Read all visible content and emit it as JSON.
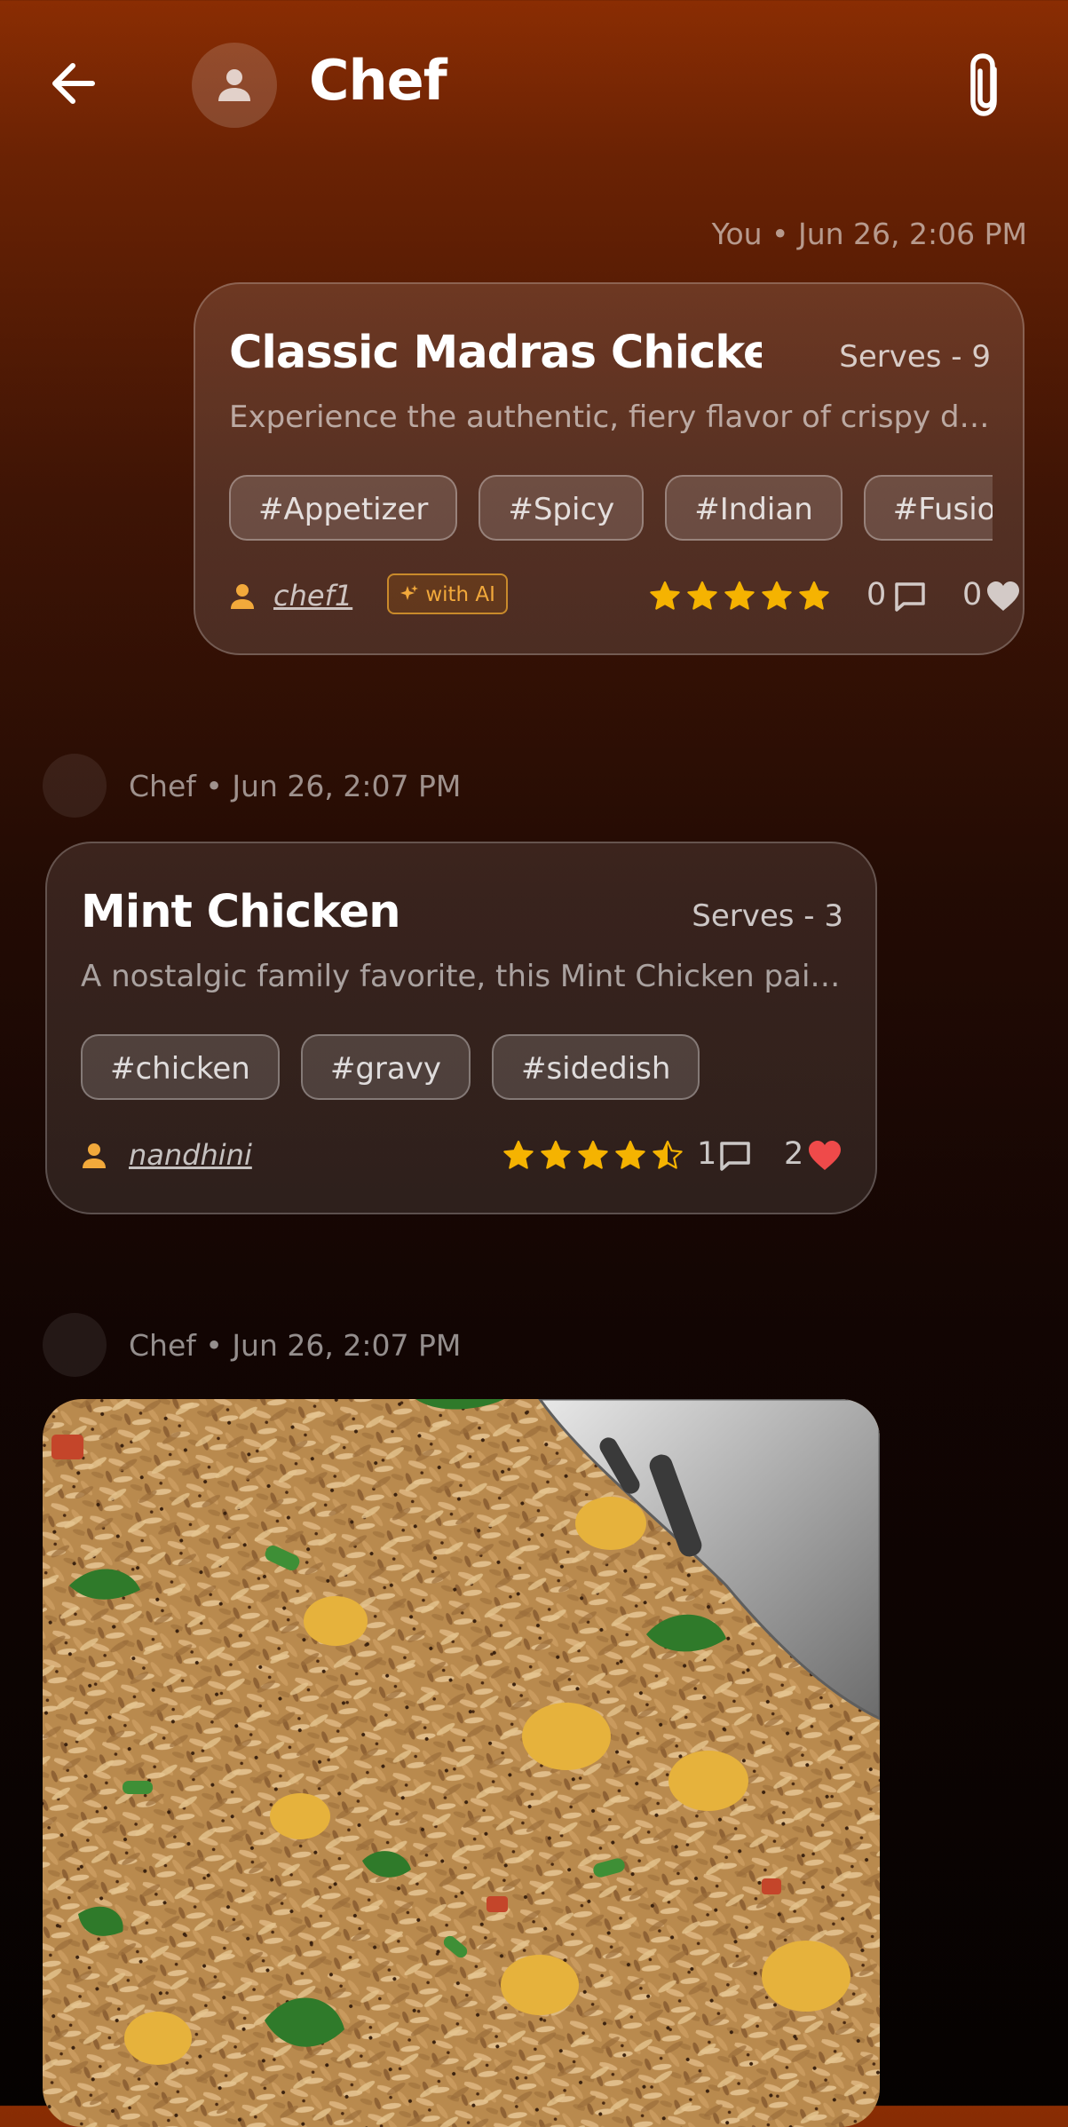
{
  "header": {
    "title": "Chef"
  },
  "messages": [
    {
      "sender": "You",
      "time": "Jun 26, 2:06 PM",
      "meta_text": "You • Jun 26, 2:06 PM",
      "recipe": {
        "title": "Classic Madras Chicken...",
        "serves": "Serves - 9",
        "description": "Experience the authentic, fiery flavor of crispy de...",
        "tags": [
          "#Appetizer",
          "#Spicy",
          "#Indian",
          "#Fusion"
        ],
        "author": "chef1",
        "ai_badge": "with AI",
        "rating": 5,
        "comments": "0",
        "likes": "0",
        "liked": false
      }
    },
    {
      "sender": "Chef",
      "time": "Jun 26, 2:07 PM",
      "meta_text": "Chef • Jun 26, 2:07 PM",
      "recipe": {
        "title": "Mint Chicken",
        "serves": "Serves - 3",
        "description": "A nostalgic family favorite, this Mint Chicken pairs...",
        "tags": [
          "#chicken",
          "#gravy",
          "#sidedish"
        ],
        "author": "nandhini",
        "rating": 4.5,
        "comments": "1",
        "likes": "2",
        "liked": true
      }
    },
    {
      "sender": "Chef",
      "time": "Jun 26, 2:07 PM",
      "meta_text": "Chef • Jun 26, 2:07 PM",
      "image": "fried-rice-photo"
    }
  ],
  "colors": {
    "accent": "#f2a93b",
    "star": "#f5b301",
    "heart_liked": "#ef4a4a",
    "background_top": "#8a2d03",
    "background_bottom": "#050201"
  },
  "icons": {
    "back": "arrow-left-icon",
    "attach": "paperclip-icon",
    "user": "person-icon",
    "comment": "comment-icon",
    "like": "heart-icon",
    "ai": "sparkle-icon",
    "star": "star-icon"
  }
}
